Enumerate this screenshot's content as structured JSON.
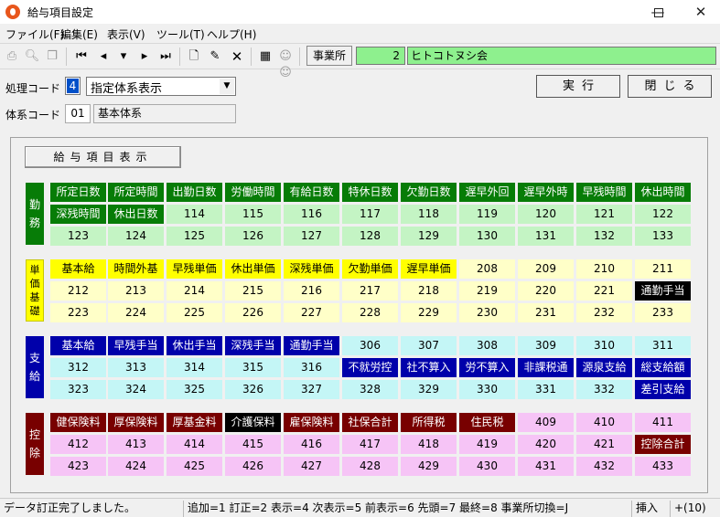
{
  "window": {
    "title": "給与項目設定"
  },
  "menu": [
    {
      "label": "ファイル(F)"
    },
    {
      "label": "編集(E)"
    },
    {
      "label": "表示(V)"
    },
    {
      "label": "ツール(T)"
    },
    {
      "label": "ヘルプ(H)"
    }
  ],
  "office": {
    "button": "事業所",
    "code": "2",
    "name": "ヒトコトヌシ会"
  },
  "form": {
    "proc_label": "処理コード",
    "proc_code": "4",
    "proc_value": "指定体系表示",
    "sys_label": "体系コード",
    "sys_code": "01",
    "sys_name": "基本体系"
  },
  "buttons": {
    "run": "実行",
    "close": "閉じる"
  },
  "panel": {
    "display_button": "給与項目表示"
  },
  "colors": {
    "work_dark": "#077c07",
    "work_light": "#c4f4c4",
    "unit_dark": "#ffff00",
    "unit_light": "#ffffc8",
    "pay_dark": "#0000aa",
    "pay_light": "#c4f6f6",
    "ded_dark": "#780000",
    "ded_light": "#f6c4f6",
    "black": "#000000"
  },
  "categories": [
    {
      "label": "勤務",
      "theme": "work",
      "rows": [
        [
          {
            "t": "所定日数",
            "s": "d"
          },
          {
            "t": "所定時間",
            "s": "d"
          },
          {
            "t": "出勤日数",
            "s": "d"
          },
          {
            "t": "労働時間",
            "s": "d"
          },
          {
            "t": "有給日数",
            "s": "d"
          },
          {
            "t": "特休日数",
            "s": "d"
          },
          {
            "t": "欠勤日数",
            "s": "d"
          },
          {
            "t": "遅早外回",
            "s": "d"
          },
          {
            "t": "遅早外時",
            "s": "d"
          },
          {
            "t": "早残時間",
            "s": "d"
          },
          {
            "t": "休出時間",
            "s": "d"
          }
        ],
        [
          {
            "t": "深残時間",
            "s": "d"
          },
          {
            "t": "休出日数",
            "s": "d"
          },
          {
            "t": "114",
            "s": "l"
          },
          {
            "t": "115",
            "s": "l"
          },
          {
            "t": "116",
            "s": "l"
          },
          {
            "t": "117",
            "s": "l"
          },
          {
            "t": "118",
            "s": "l"
          },
          {
            "t": "119",
            "s": "l"
          },
          {
            "t": "120",
            "s": "l"
          },
          {
            "t": "121",
            "s": "l"
          },
          {
            "t": "122",
            "s": "l"
          }
        ],
        [
          {
            "t": "123",
            "s": "l"
          },
          {
            "t": "124",
            "s": "l"
          },
          {
            "t": "125",
            "s": "l"
          },
          {
            "t": "126",
            "s": "l"
          },
          {
            "t": "127",
            "s": "l"
          },
          {
            "t": "128",
            "s": "l"
          },
          {
            "t": "129",
            "s": "l"
          },
          {
            "t": "130",
            "s": "l"
          },
          {
            "t": "131",
            "s": "l"
          },
          {
            "t": "132",
            "s": "l"
          },
          {
            "t": "133",
            "s": "l"
          }
        ]
      ]
    },
    {
      "label": "単価基礎",
      "theme": "unit",
      "rows": [
        [
          {
            "t": "基本給",
            "s": "d"
          },
          {
            "t": "時間外基",
            "s": "d"
          },
          {
            "t": "早残単価",
            "s": "d"
          },
          {
            "t": "休出単価",
            "s": "d"
          },
          {
            "t": "深残単価",
            "s": "d"
          },
          {
            "t": "欠勤単価",
            "s": "d"
          },
          {
            "t": "遅早単価",
            "s": "d"
          },
          {
            "t": "208",
            "s": "l"
          },
          {
            "t": "209",
            "s": "l"
          },
          {
            "t": "210",
            "s": "l"
          },
          {
            "t": "211",
            "s": "l"
          }
        ],
        [
          {
            "t": "212",
            "s": "l"
          },
          {
            "t": "213",
            "s": "l"
          },
          {
            "t": "214",
            "s": "l"
          },
          {
            "t": "215",
            "s": "l"
          },
          {
            "t": "216",
            "s": "l"
          },
          {
            "t": "217",
            "s": "l"
          },
          {
            "t": "218",
            "s": "l"
          },
          {
            "t": "219",
            "s": "l"
          },
          {
            "t": "220",
            "s": "l"
          },
          {
            "t": "221",
            "s": "l"
          },
          {
            "t": "通勤手当",
            "s": "b"
          }
        ],
        [
          {
            "t": "223",
            "s": "l"
          },
          {
            "t": "224",
            "s": "l"
          },
          {
            "t": "225",
            "s": "l"
          },
          {
            "t": "226",
            "s": "l"
          },
          {
            "t": "227",
            "s": "l"
          },
          {
            "t": "228",
            "s": "l"
          },
          {
            "t": "229",
            "s": "l"
          },
          {
            "t": "230",
            "s": "l"
          },
          {
            "t": "231",
            "s": "l"
          },
          {
            "t": "232",
            "s": "l"
          },
          {
            "t": "233",
            "s": "l"
          }
        ]
      ]
    },
    {
      "label": "支給",
      "theme": "pay",
      "rows": [
        [
          {
            "t": "基本給",
            "s": "d"
          },
          {
            "t": "早残手当",
            "s": "d"
          },
          {
            "t": "休出手当",
            "s": "d"
          },
          {
            "t": "深残手当",
            "s": "d"
          },
          {
            "t": "通勤手当",
            "s": "d"
          },
          {
            "t": "306",
            "s": "l"
          },
          {
            "t": "307",
            "s": "l"
          },
          {
            "t": "308",
            "s": "l"
          },
          {
            "t": "309",
            "s": "l"
          },
          {
            "t": "310",
            "s": "l"
          },
          {
            "t": "311",
            "s": "l"
          }
        ],
        [
          {
            "t": "312",
            "s": "l"
          },
          {
            "t": "313",
            "s": "l"
          },
          {
            "t": "314",
            "s": "l"
          },
          {
            "t": "315",
            "s": "l"
          },
          {
            "t": "316",
            "s": "l"
          },
          {
            "t": "不就労控",
            "s": "d"
          },
          {
            "t": "社不算入",
            "s": "d"
          },
          {
            "t": "労不算入",
            "s": "d"
          },
          {
            "t": "非課税通",
            "s": "d"
          },
          {
            "t": "源泉支給",
            "s": "d"
          },
          {
            "t": "総支給額",
            "s": "d"
          }
        ],
        [
          {
            "t": "323",
            "s": "l"
          },
          {
            "t": "324",
            "s": "l"
          },
          {
            "t": "325",
            "s": "l"
          },
          {
            "t": "326",
            "s": "l"
          },
          {
            "t": "327",
            "s": "l"
          },
          {
            "t": "328",
            "s": "l"
          },
          {
            "t": "329",
            "s": "l"
          },
          {
            "t": "330",
            "s": "l"
          },
          {
            "t": "331",
            "s": "l"
          },
          {
            "t": "332",
            "s": "l"
          },
          {
            "t": "差引支給",
            "s": "d"
          }
        ]
      ]
    },
    {
      "label": "控除",
      "theme": "ded",
      "rows": [
        [
          {
            "t": "健保険料",
            "s": "d"
          },
          {
            "t": "厚保険料",
            "s": "d"
          },
          {
            "t": "厚基金料",
            "s": "d"
          },
          {
            "t": "介護保料",
            "s": "b"
          },
          {
            "t": "雇保険料",
            "s": "d"
          },
          {
            "t": "社保合計",
            "s": "d"
          },
          {
            "t": "所得税",
            "s": "d"
          },
          {
            "t": "住民税",
            "s": "d"
          },
          {
            "t": "409",
            "s": "l"
          },
          {
            "t": "410",
            "s": "l"
          },
          {
            "t": "411",
            "s": "l"
          }
        ],
        [
          {
            "t": "412",
            "s": "l"
          },
          {
            "t": "413",
            "s": "l"
          },
          {
            "t": "414",
            "s": "l"
          },
          {
            "t": "415",
            "s": "l"
          },
          {
            "t": "416",
            "s": "l"
          },
          {
            "t": "417",
            "s": "l"
          },
          {
            "t": "418",
            "s": "l"
          },
          {
            "t": "419",
            "s": "l"
          },
          {
            "t": "420",
            "s": "l"
          },
          {
            "t": "421",
            "s": "l"
          },
          {
            "t": "控除合計",
            "s": "d"
          }
        ],
        [
          {
            "t": "423",
            "s": "l"
          },
          {
            "t": "424",
            "s": "l"
          },
          {
            "t": "425",
            "s": "l"
          },
          {
            "t": "426",
            "s": "l"
          },
          {
            "t": "427",
            "s": "l"
          },
          {
            "t": "428",
            "s": "l"
          },
          {
            "t": "429",
            "s": "l"
          },
          {
            "t": "430",
            "s": "l"
          },
          {
            "t": "431",
            "s": "l"
          },
          {
            "t": "432",
            "s": "l"
          },
          {
            "t": "433",
            "s": "l"
          }
        ]
      ]
    }
  ],
  "status": {
    "message": "データ訂正完了しました。",
    "keys": "追加=1 訂正=2 表示=4 次表示=5 前表示=6 先頭=7 最終=8 事業所切換=J",
    "mode": "挿入",
    "extra": "+(10)"
  },
  "icons": [
    "print-icon",
    "print-preview-icon",
    "copy-icon",
    "first-record-icon",
    "prev-record-icon",
    "dropdown-icon",
    "next-record-icon",
    "last-record-icon",
    "new-document-icon",
    "edit-icon",
    "delete-icon",
    "calculator-icon",
    "employees-icon"
  ]
}
